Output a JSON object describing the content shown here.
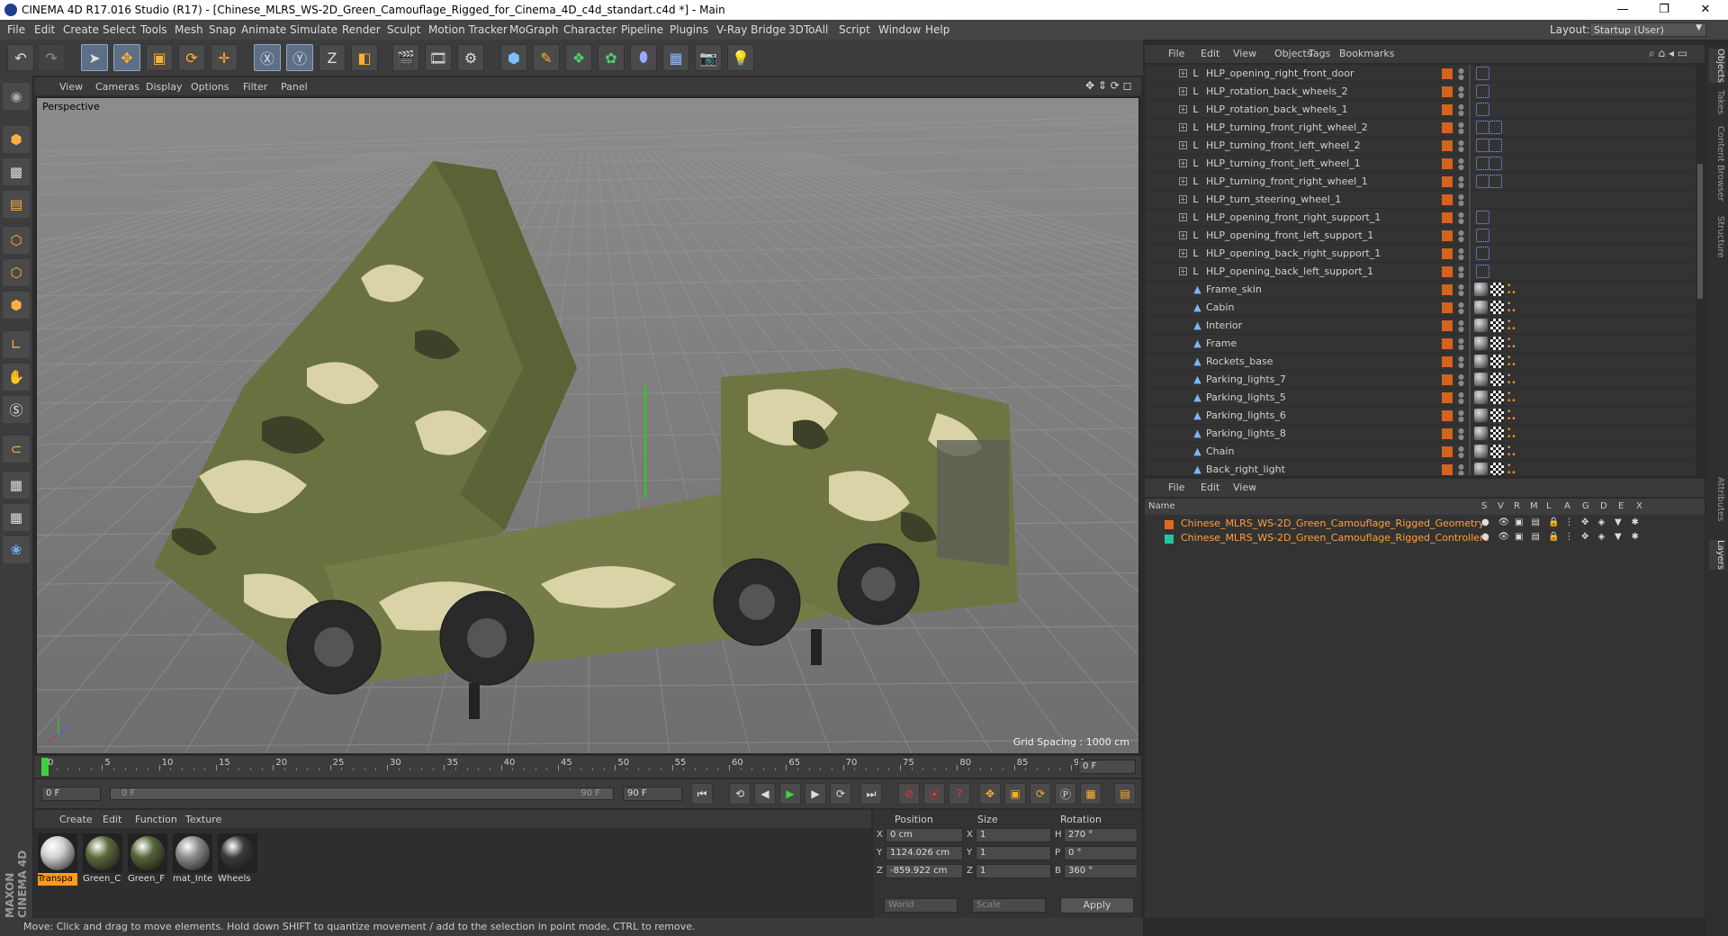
{
  "window": {
    "title": "CINEMA 4D R17.016 Studio (R17) - [Chinese_MLRS_WS-2D_Green_Camouflage_Rigged_for_Cinema_4D_c4d_standart.c4d *] - Main",
    "layout_label": "Layout:",
    "layout_value": "Startup (User)"
  },
  "menu": [
    "File",
    "Edit",
    "Create",
    "Select",
    "Tools",
    "Mesh",
    "Snap",
    "Animate",
    "Simulate",
    "Render",
    "Sculpt",
    "Motion Tracker",
    "MoGraph",
    "Character",
    "Pipeline",
    "Plugins",
    "V-Ray Bridge",
    "3DToAll",
    "Script",
    "Window",
    "Help"
  ],
  "viewport": {
    "menu": [
      "View",
      "Cameras",
      "Display",
      "Options",
      "Filter",
      "Panel"
    ],
    "label": "Perspective",
    "grid_spacing": "Grid Spacing : 1000 cm"
  },
  "timeline": {
    "ticks": [
      "0",
      "5",
      "10",
      "15",
      "20",
      "25",
      "30",
      "35",
      "40",
      "45",
      "50",
      "55",
      "60",
      "65",
      "70",
      "75",
      "80",
      "85",
      "90"
    ],
    "current_frame": "0 F",
    "start_frame": "0 F",
    "range_start": "0 F",
    "range_end": "90 F",
    "end_frame": "90 F"
  },
  "materials": {
    "menu": [
      "Create",
      "Edit",
      "Function",
      "Texture"
    ],
    "items": [
      {
        "label": "Transpa",
        "color": "#cfcfcf"
      },
      {
        "label": "Green_C",
        "color": "#5b6a3a"
      },
      {
        "label": "Green_F",
        "color": "#566338"
      },
      {
        "label": "mat_Inte",
        "color": "#8a8d8a"
      },
      {
        "label": "Wheels",
        "color": "#3a3a38"
      }
    ]
  },
  "coords": {
    "headers": [
      "Position",
      "Size",
      "Rotation"
    ],
    "rows": [
      {
        "axis": "X",
        "pos": "0 cm",
        "size_axis": "X",
        "size": "1",
        "rot_axis": "H",
        "rot": "270 °"
      },
      {
        "axis": "Y",
        "pos": "1124.026 cm",
        "size_axis": "Y",
        "size": "1",
        "rot_axis": "P",
        "rot": "0 °"
      },
      {
        "axis": "Z",
        "pos": "-859.922 cm",
        "size_axis": "Z",
        "size": "1",
        "rot_axis": "B",
        "rot": "360 °"
      }
    ],
    "world": "World",
    "scale": "Scale",
    "apply": "Apply"
  },
  "status": "Move: Click and drag to move elements. Hold down SHIFT to quantize movement / add to the selection in point mode, CTRL to remove.",
  "objects": {
    "menu": [
      "File",
      "Edit",
      "View",
      "Objects",
      "Tags",
      "Bookmarks"
    ],
    "rows": [
      {
        "name": "HLP_opening_right_front_door",
        "type": "null",
        "tags": 1
      },
      {
        "name": "HLP_rotation_back_wheels_2",
        "type": "null",
        "tags": 1
      },
      {
        "name": "HLP_rotation_back_wheels_1",
        "type": "null",
        "tags": 1
      },
      {
        "name": "HLP_turning_front_right_wheel_2",
        "type": "null",
        "tags": 2
      },
      {
        "name": "HLP_turning_front_left_wheel_2",
        "type": "null",
        "tags": 2
      },
      {
        "name": "HLP_turning_front_left_wheel_1",
        "type": "null",
        "tags": 2
      },
      {
        "name": "HLP_turning_front_right_wheel_1",
        "type": "null",
        "tags": 2
      },
      {
        "name": "HLP_turn_steering_wheel_1",
        "type": "null",
        "tags": 0
      },
      {
        "name": "HLP_opening_front_right_support_1",
        "type": "null",
        "tags": 1
      },
      {
        "name": "HLP_opening_front_left_support_1",
        "type": "null",
        "tags": 1
      },
      {
        "name": "HLP_opening_back_right_support_1",
        "type": "null",
        "tags": 1
      },
      {
        "name": "HLP_opening_back_left_support_1",
        "type": "null",
        "tags": 1
      },
      {
        "name": "Frame_skin",
        "type": "mesh",
        "tags": 3
      },
      {
        "name": "Cabin",
        "type": "mesh",
        "tags": 3
      },
      {
        "name": "Interior",
        "type": "mesh",
        "tags": 3
      },
      {
        "name": "Frame",
        "type": "mesh",
        "tags": 3
      },
      {
        "name": "Rockets_base",
        "type": "mesh",
        "tags": 3
      },
      {
        "name": "Parking_lights_7",
        "type": "mesh",
        "tags": 3
      },
      {
        "name": "Parking_lights_5",
        "type": "mesh",
        "tags": 3
      },
      {
        "name": "Parking_lights_6",
        "type": "mesh",
        "tags": 3
      },
      {
        "name": "Parking_lights_8",
        "type": "mesh",
        "tags": 3
      },
      {
        "name": "Chain",
        "type": "mesh",
        "tags": 3
      },
      {
        "name": "Back_right_light",
        "type": "mesh",
        "tags": 3
      }
    ]
  },
  "layers": {
    "menu": [
      "File",
      "Edit",
      "View"
    ],
    "headers": [
      "Name",
      "S",
      "V",
      "R",
      "M",
      "L",
      "A",
      "G",
      "D",
      "E",
      "X"
    ],
    "rows": [
      {
        "name": "Chinese_MLRS_WS-2D_Green_Camouflage_Rigged_Geometry",
        "color": "#e06a1c"
      },
      {
        "name": "Chinese_MLRS_WS-2D_Green_Camouflage_Rigged_Controllers",
        "color": "#1fc89a"
      }
    ]
  },
  "right_tabs": [
    "Objects",
    "Takes",
    "Content Browser",
    "Structure",
    "Attributes",
    "Layers"
  ],
  "colors": {
    "accent": "#ffa040",
    "layer_orange": "#d2641e",
    "play_green": "#3bd33b"
  }
}
